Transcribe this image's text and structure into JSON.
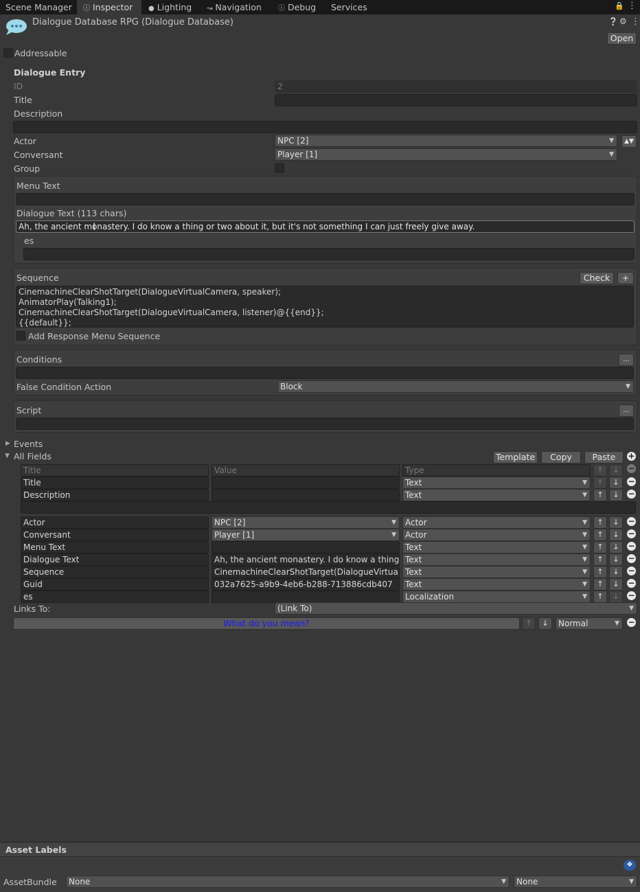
{
  "tabs": [
    "Scene Manager",
    "Inspector",
    "Lighting",
    "Navigation",
    "Debug",
    "Services"
  ],
  "header": {
    "title": "Dialogue Database RPG (Dialogue Database)",
    "open_label": "Open",
    "addressable_label": "Addressable"
  },
  "entry": {
    "section_title": "Dialogue Entry",
    "id_label": "ID",
    "id_value": "2",
    "title_label": "Title",
    "title_value": "",
    "description_label": "Description",
    "description_value": "",
    "actor_label": "Actor",
    "actor_value": "NPC [2]",
    "conversant_label": "Conversant",
    "conversant_value": "Player [1]",
    "group_label": "Group"
  },
  "text_section": {
    "menu_text_label": "Menu Text",
    "menu_text_value": "",
    "dialogue_text_label": "Dialogue Text (113 chars)",
    "dialogue_text_value": "Ah, the ancient monastery. I do know a thing or two about it, but it's not something I can just freely give away.",
    "es_label": "es",
    "es_value": ""
  },
  "sequence": {
    "label": "Sequence",
    "check_label": "Check",
    "plus_label": "+",
    "lines": [
      "CinemachineClearShotTarget(DialogueVirtualCamera, speaker);",
      "AnimatorPlay(Talking1);",
      "CinemachineClearShotTarget(DialogueVirtualCamera, listener)@{{end}};",
      "{{default}};"
    ],
    "add_response_label": "Add Response Menu Sequence"
  },
  "conditions": {
    "label": "Conditions",
    "more_label": "...",
    "value": "",
    "false_action_label": "False Condition Action",
    "false_action_value": "Block"
  },
  "script": {
    "label": "Script",
    "more_label": "...",
    "value": ""
  },
  "events_label": "Events",
  "all_fields": {
    "label": "All Fields",
    "template_label": "Template",
    "copy_label": "Copy",
    "paste_label": "Paste",
    "headers": [
      "Title",
      "Value",
      "Type"
    ],
    "rows": [
      {
        "title": "Title",
        "value": "",
        "type": "Text",
        "kind": "text"
      },
      {
        "title": "Description",
        "value": "",
        "type": "Text",
        "kind": "text"
      },
      {
        "title": "Actor",
        "value": "NPC [2]",
        "type": "Actor",
        "kind": "drop"
      },
      {
        "title": "Conversant",
        "value": "Player [1]",
        "type": "Actor",
        "kind": "drop"
      },
      {
        "title": "Menu Text",
        "value": "",
        "type": "Text",
        "kind": "text"
      },
      {
        "title": "Dialogue Text",
        "value": "Ah, the ancient monastery. I do know a thing or",
        "type": "Text",
        "kind": "text"
      },
      {
        "title": "Sequence",
        "value": "CinemachineClearShotTarget(DialogueVirtualC",
        "type": "Text",
        "kind": "text"
      },
      {
        "title": "Guid",
        "value": "032a7625-a9b9-4eb6-b288-713886cdb407",
        "type": "Text",
        "kind": "text"
      },
      {
        "title": "es",
        "value": "",
        "type": "Localization",
        "kind": "text"
      }
    ]
  },
  "links": {
    "label": "Links To:",
    "dropdown_value": "(Link To)",
    "link_text": "What do you mean?",
    "priority_value": "Normal"
  },
  "asset_labels": {
    "label": "Asset Labels",
    "assetbundle_label": "AssetBundle",
    "bundle_value": "None",
    "variant_value": "None"
  },
  "colors": {
    "link": "#1a1aff",
    "background": "#383838",
    "tabbar": "#191919"
  }
}
